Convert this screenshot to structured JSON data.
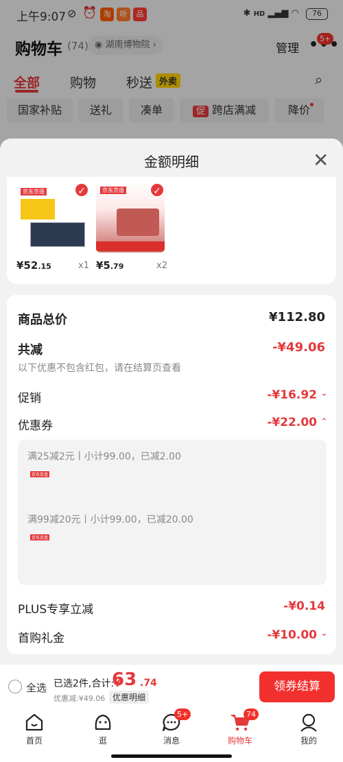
{
  "status_bar": {
    "time": "上午9:07",
    "app_icons": [
      "淘",
      "听",
      "品"
    ],
    "battery": "76",
    "signal_text": "HD"
  },
  "header": {
    "title": "购物车",
    "count": "(74)",
    "location": "湖南博物院",
    "manage": "管理",
    "more_badge": "5+"
  },
  "tabs": [
    {
      "label": "全部",
      "active": true
    },
    {
      "label": "购物",
      "active": false
    },
    {
      "label": "秒送",
      "active": false
    }
  ],
  "waimai_tag": "外卖",
  "filters": [
    "国家补贴",
    "送礼",
    "凑单",
    "跨店满减",
    "降价"
  ],
  "promo_tag": "促",
  "sheet": {
    "title": "金额明细",
    "products": [
      {
        "price_main": "¥52",
        "price_dec": ".15",
        "qty": "x1"
      },
      {
        "price_main": "¥5",
        "price_dec": ".79",
        "qty": "x2"
      }
    ],
    "summary": {
      "goods_total_label": "商品总价",
      "goods_total_value": "¥112.80",
      "reduce_label": "共减",
      "reduce_value": "-¥49.06",
      "reduce_note": "以下优惠不包含红包，请在结算页查看",
      "promo_label": "促销",
      "promo_value": "-¥16.92",
      "coupon_label": "优惠券",
      "coupon_value": "-¥22.00",
      "coupons": [
        {
          "info": "满25减2元丨小计99.00，已减2.00"
        },
        {
          "info": "满99减20元丨小计99.00，已减20.00"
        }
      ],
      "plus_label": "PLUS专享立减",
      "plus_value": "-¥0.14",
      "first_label": "首购礼金",
      "first_value": "-¥10.00"
    }
  },
  "bottom_bar": {
    "select_all": "全选",
    "selected_text": "已选2件,合计:",
    "currency": "¥",
    "total_main": "63",
    "total_dec": ".74",
    "saved": "优惠减:¥49.06",
    "detail_btn": "优惠明细",
    "checkout": "领券结算"
  },
  "nav": [
    {
      "label": "首页",
      "icon": "home-icon"
    },
    {
      "label": "逛",
      "icon": "explore-icon"
    },
    {
      "label": "消息",
      "icon": "message-icon",
      "badge": "5+"
    },
    {
      "label": "购物车",
      "icon": "cart-icon",
      "badge": "74",
      "active": true
    },
    {
      "label": "我的",
      "icon": "profile-icon"
    }
  ],
  "colors": {
    "accent": "#e4393c",
    "checkout": "#f2302e",
    "yellow_tag": "#ffd200"
  }
}
